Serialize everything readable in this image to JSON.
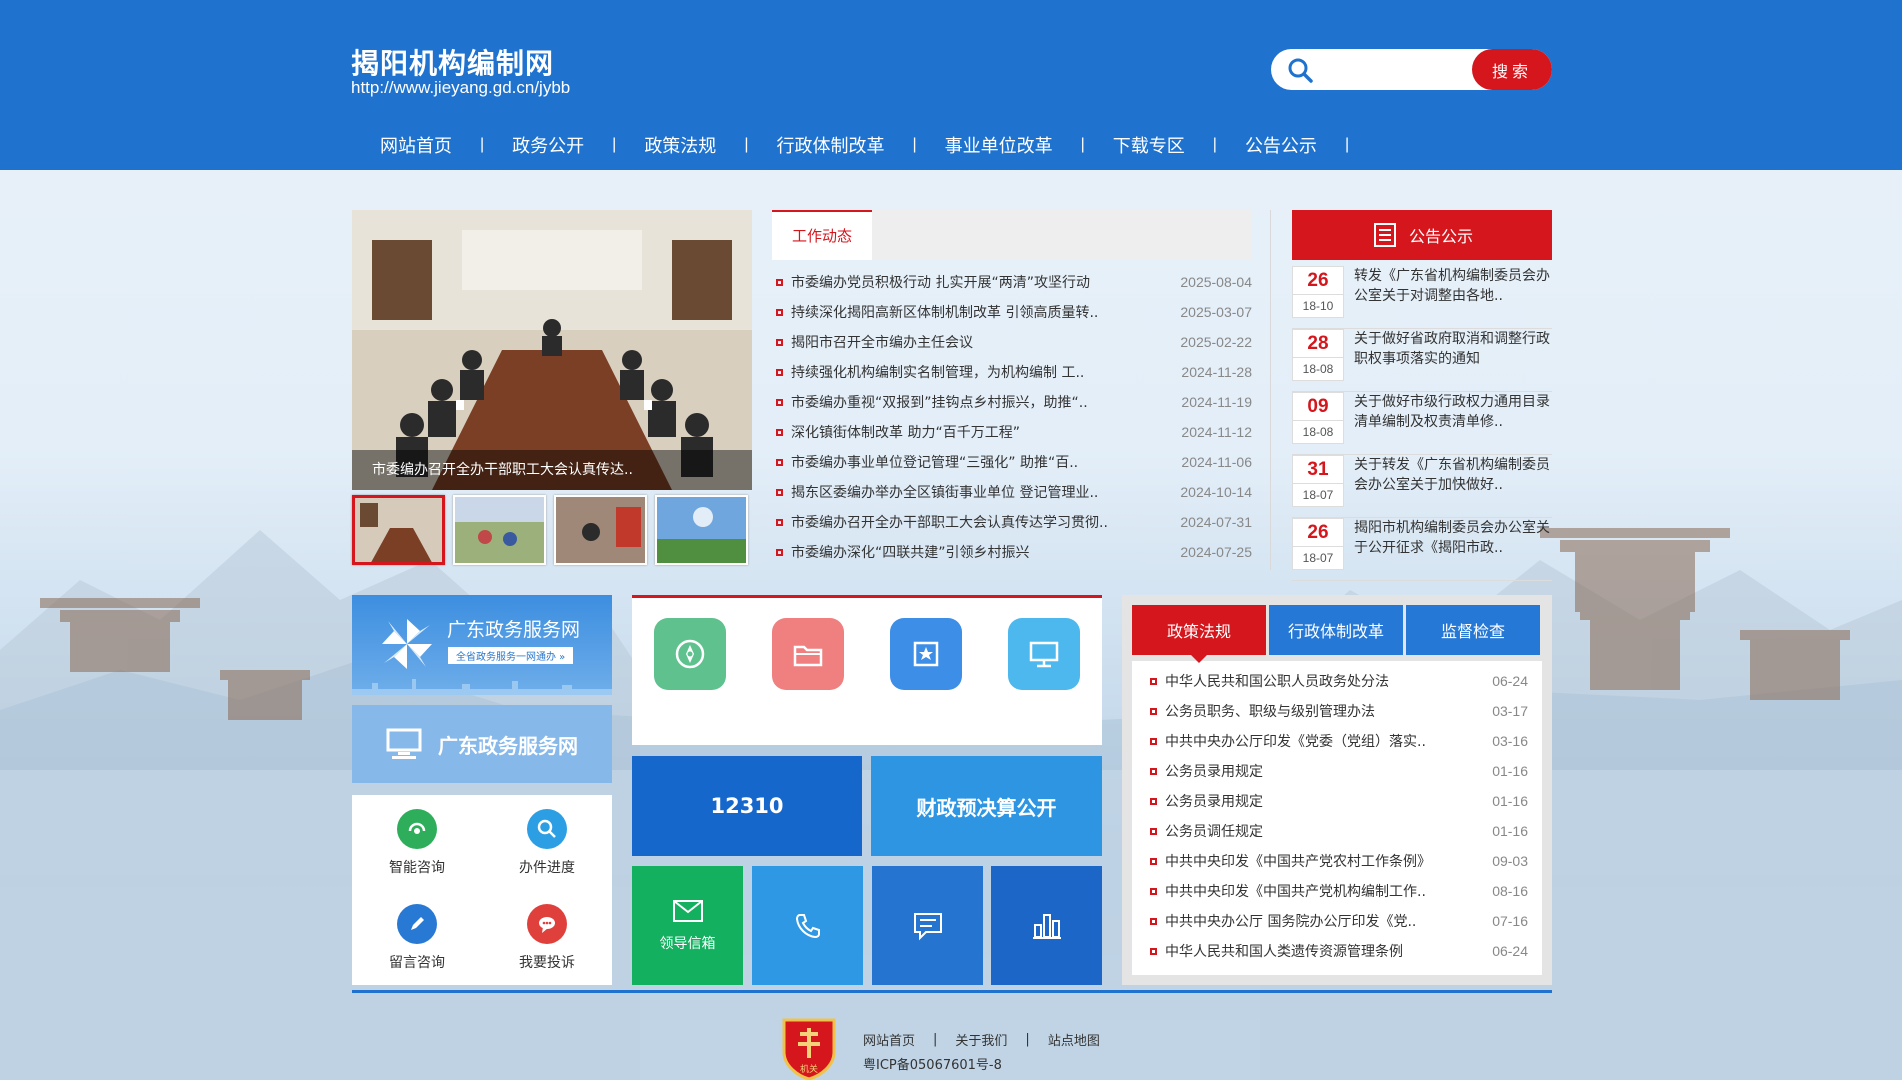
{
  "site": {
    "title": "揭阳机构编制网",
    "url": "http://www.jieyang.gd.cn/jybb"
  },
  "search": {
    "placeholder": "",
    "button": "搜索"
  },
  "nav": [
    "网站首页",
    "政务公开",
    "政策法规",
    "行政体制改革",
    "事业单位改革",
    "下载专区",
    "公告公示"
  ],
  "carousel": {
    "caption": "市委编办召开全办干部职工大会认真传达.."
  },
  "news": {
    "tab": "工作动态",
    "items": [
      {
        "title": "市委编办党员积极行动 扎实开展“两清”攻坚行动",
        "date": "2025-08-04"
      },
      {
        "title": "持续深化揭阳高新区体制机制改革 引领高质量转..",
        "date": "2025-03-07"
      },
      {
        "title": "揭阳市召开全市编办主任会议",
        "date": "2025-02-22"
      },
      {
        "title": "持续强化机构编制实名制管理，为机构编制 工..",
        "date": "2024-11-28"
      },
      {
        "title": "市委编办重视“双报到”挂钩点乡村振兴，助推“..",
        "date": "2024-11-19"
      },
      {
        "title": "深化镇街体制改革 助力“百千万工程”",
        "date": "2024-11-12"
      },
      {
        "title": "市委编办事业单位登记管理“三强化” 助推“百..",
        "date": "2024-11-06"
      },
      {
        "title": "揭东区委编办举办全区镇街事业单位 登记管理业..",
        "date": "2024-10-14"
      },
      {
        "title": "市委编办召开全办干部职工大会认真传达学习贯彻..",
        "date": "2024-07-31"
      },
      {
        "title": "市委编办深化“四联共建”引领乡村振兴",
        "date": "2024-07-25"
      }
    ]
  },
  "announcements": {
    "title": "公告公示",
    "items": [
      {
        "day": "26",
        "ym": "18-10",
        "text": "转发《广东省机构编制委员会办公室关于对调整由各地.."
      },
      {
        "day": "28",
        "ym": "18-08",
        "text": "关于做好省政府取消和调整行政职权事项落实的通知"
      },
      {
        "day": "09",
        "ym": "18-08",
        "text": "关于做好市级行政权力通用目录清单编制及权责清单修.."
      },
      {
        "day": "31",
        "ym": "18-07",
        "text": "关于转发《广东省机构编制委员会办公室关于加快做好.."
      },
      {
        "day": "26",
        "ym": "18-07",
        "text": "揭阳市机构编制委员会办公室关于公开征求《揭阳市政.."
      }
    ]
  },
  "services": {
    "banner1_title": "广东政务服务网",
    "banner1_sub": "全省政务服务一网通办 »",
    "banner2_title": "广东政务服务网",
    "items": [
      {
        "label": "智能咨询",
        "color": "#2eae5b"
      },
      {
        "label": "办件进度",
        "color": "#2c9ee3"
      },
      {
        "label": "留言咨询",
        "color": "#2879d3"
      },
      {
        "label": "我要投诉",
        "color": "#e0403c"
      }
    ]
  },
  "quick_icons": [
    {
      "name": "compass",
      "color": "#5fc28e"
    },
    {
      "name": "folder",
      "color": "#f07f7f"
    },
    {
      "name": "star-doc",
      "color": "#3d8ee6"
    },
    {
      "name": "monitor",
      "color": "#4db8ee"
    }
  ],
  "tiles": {
    "t12310": "12310",
    "budget": "财政预决算公开",
    "mailbox": "领导信箱",
    "colors": {
      "green": "#12b05f",
      "lightblue": "#2f98e4",
      "blue": "#2474d0",
      "dark": "#1b66c6"
    }
  },
  "policy": {
    "tabs": [
      "政策法规",
      "行政体制改革",
      "监督检查"
    ],
    "items": [
      {
        "title": "中华人民共和国公职人员政务处分法",
        "date": "06-24"
      },
      {
        "title": "公务员职务、职级与级别管理办法",
        "date": "03-17"
      },
      {
        "title": "中共中央办公厅印发《党委（党组）落实..",
        "date": "03-16"
      },
      {
        "title": "公务员录用规定",
        "date": "01-16"
      },
      {
        "title": "公务员录用规定",
        "date": "01-16"
      },
      {
        "title": "公务员调任规定",
        "date": "01-16"
      },
      {
        "title": "中共中央印发《中国共产党农村工作条例》",
        "date": "09-03"
      },
      {
        "title": "中共中央印发《中国共产党机构编制工作..",
        "date": "08-16"
      },
      {
        "title": "中共中央办公厅 国务院办公厅印发《党..",
        "date": "07-16"
      },
      {
        "title": "中华人民共和国人类遗传资源管理条例",
        "date": "06-24"
      }
    ]
  },
  "footer": {
    "links": [
      "网站首页",
      "关于我们",
      "站点地图"
    ],
    "icp": "粤ICP备05067601号-8",
    "emblem_text": "机关"
  },
  "colors": {
    "brand_blue": "#1f73cf",
    "brand_red": "#d5161d"
  }
}
